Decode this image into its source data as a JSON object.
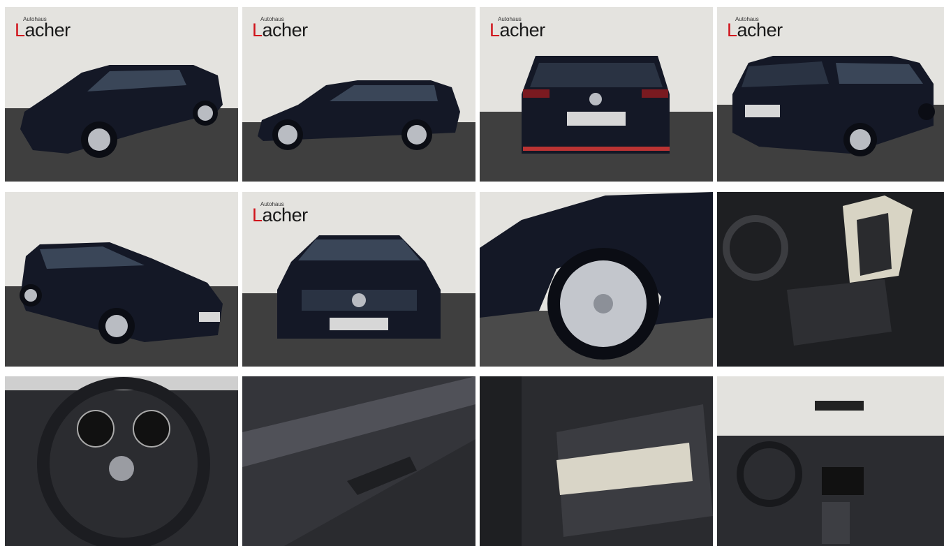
{
  "gallery": {
    "tiles": [
      {
        "subject": "front-left-exterior",
        "logo": "Autohaus Lacher"
      },
      {
        "subject": "left-side-exterior",
        "logo": "Autohaus Lacher"
      },
      {
        "subject": "rear-exterior",
        "logo": "Autohaus Lacher"
      },
      {
        "subject": "rear-left-exterior",
        "logo": "Autohaus Lacher"
      },
      {
        "subject": "front-right-exterior",
        "logo": ""
      },
      {
        "subject": "front-exterior",
        "logo": "Autohaus Lacher"
      },
      {
        "subject": "wheel-detail",
        "logo": ""
      },
      {
        "subject": "front-seats-interior",
        "logo": ""
      },
      {
        "subject": "steering-wheel-interior",
        "logo": ""
      },
      {
        "subject": "door-panel-interior",
        "logo": ""
      },
      {
        "subject": "rear-seats-interior",
        "logo": ""
      },
      {
        "subject": "dashboard-interior",
        "logo": ""
      }
    ],
    "logo": {
      "small": "Autohaus",
      "first": "L",
      "rest": "acher"
    },
    "colors": {
      "backdrop": "#e4e3df",
      "floor": "#3f3f3f",
      "car": "#141826",
      "brand_red": "#d0141c"
    }
  }
}
